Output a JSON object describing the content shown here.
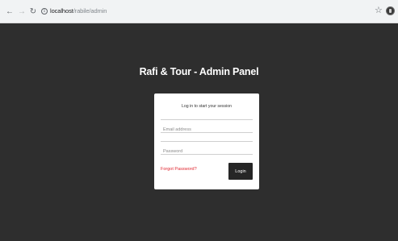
{
  "browser": {
    "url_host": "localhost",
    "url_path": "/rabile/admin",
    "icons": [
      "back-icon",
      "forward-icon",
      "reload-icon",
      "info-icon",
      "star-icon",
      "profile-icon"
    ]
  },
  "page": {
    "title": "Rafi & Tour - Admin Panel"
  },
  "login": {
    "message": "Log in to start your session",
    "email_placeholder": "Email address",
    "password_placeholder": "Password",
    "forgot_label": "Forgot Password?",
    "login_label": "Login"
  },
  "colors": {
    "background": "#2e2e2e",
    "card": "#ffffff",
    "forgot_link": "#e0262f",
    "button": "#262626"
  }
}
